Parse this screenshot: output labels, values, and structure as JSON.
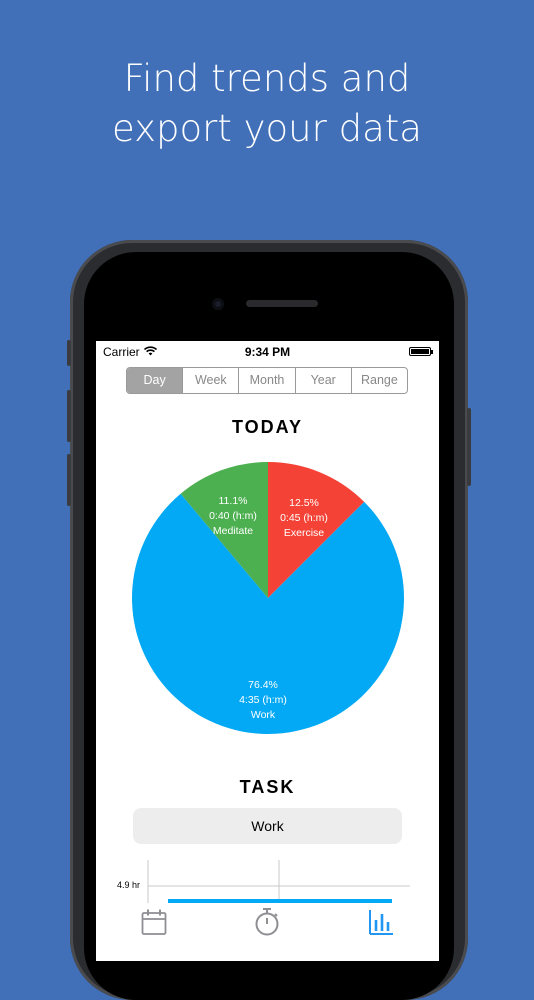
{
  "headline": {
    "line1": "Find trends and",
    "line2": "export your data"
  },
  "status_bar": {
    "carrier": "Carrier",
    "time": "9:34 PM"
  },
  "segments": [
    {
      "label": "Day",
      "active": true
    },
    {
      "label": "Week",
      "active": false
    },
    {
      "label": "Month",
      "active": false
    },
    {
      "label": "Year",
      "active": false
    },
    {
      "label": "Range",
      "active": false
    }
  ],
  "today_title": "TODAY",
  "chart_data": {
    "type": "pie",
    "slices": [
      {
        "name": "Exercise",
        "percent_label": "12.5%",
        "duration": "0:45 (h:m)",
        "value": 12.5,
        "color": "#f44336"
      },
      {
        "name": "Work",
        "percent_label": "76.4%",
        "duration": "4:35 (h:m)",
        "value": 76.4,
        "color": "#03a9f4"
      },
      {
        "name": "Meditate",
        "percent_label": "11.1%",
        "duration": "0:40 (h:m)",
        "value": 11.1,
        "color": "#4caf50"
      }
    ]
  },
  "task_title": "TASK",
  "task_selected": "Work",
  "task_chart": {
    "ytick_label": "4.9 hr",
    "bar_color": "#03a9f4"
  },
  "tabbar": {
    "icons": [
      "calendar-icon",
      "stopwatch-icon",
      "bar-chart-icon"
    ],
    "active_color": "#2196f3",
    "inactive_color": "#8e8e93"
  }
}
